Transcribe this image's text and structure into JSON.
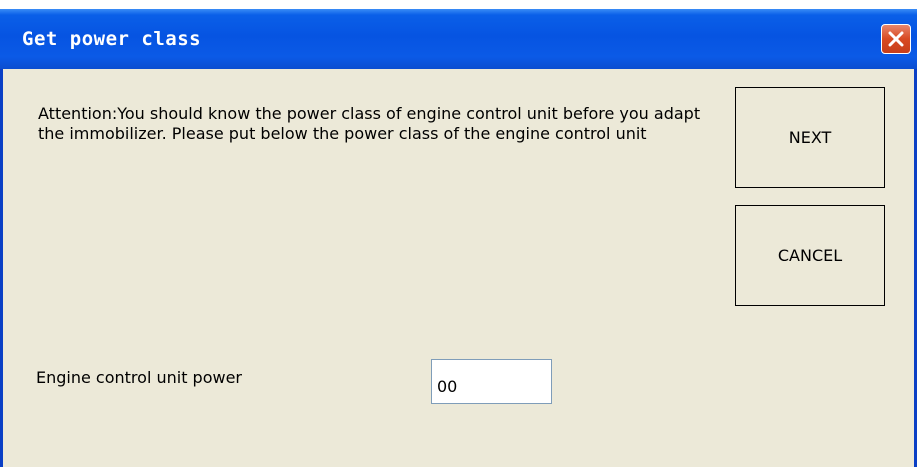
{
  "window": {
    "title": "Get power class",
    "close_icon": "close-icon",
    "colors": {
      "titlebar": "#0654e2",
      "background": "#ece9d8",
      "close_button": "#d84a22"
    }
  },
  "main": {
    "message": "Attention:You should know the power class of engine control unit before you adapt the immobilizer. Please put below the power class of the engine control unit",
    "field_label": "Engine control unit power",
    "field_value": "00"
  },
  "buttons": {
    "next_label": "NEXT",
    "cancel_label": "CANCEL"
  }
}
